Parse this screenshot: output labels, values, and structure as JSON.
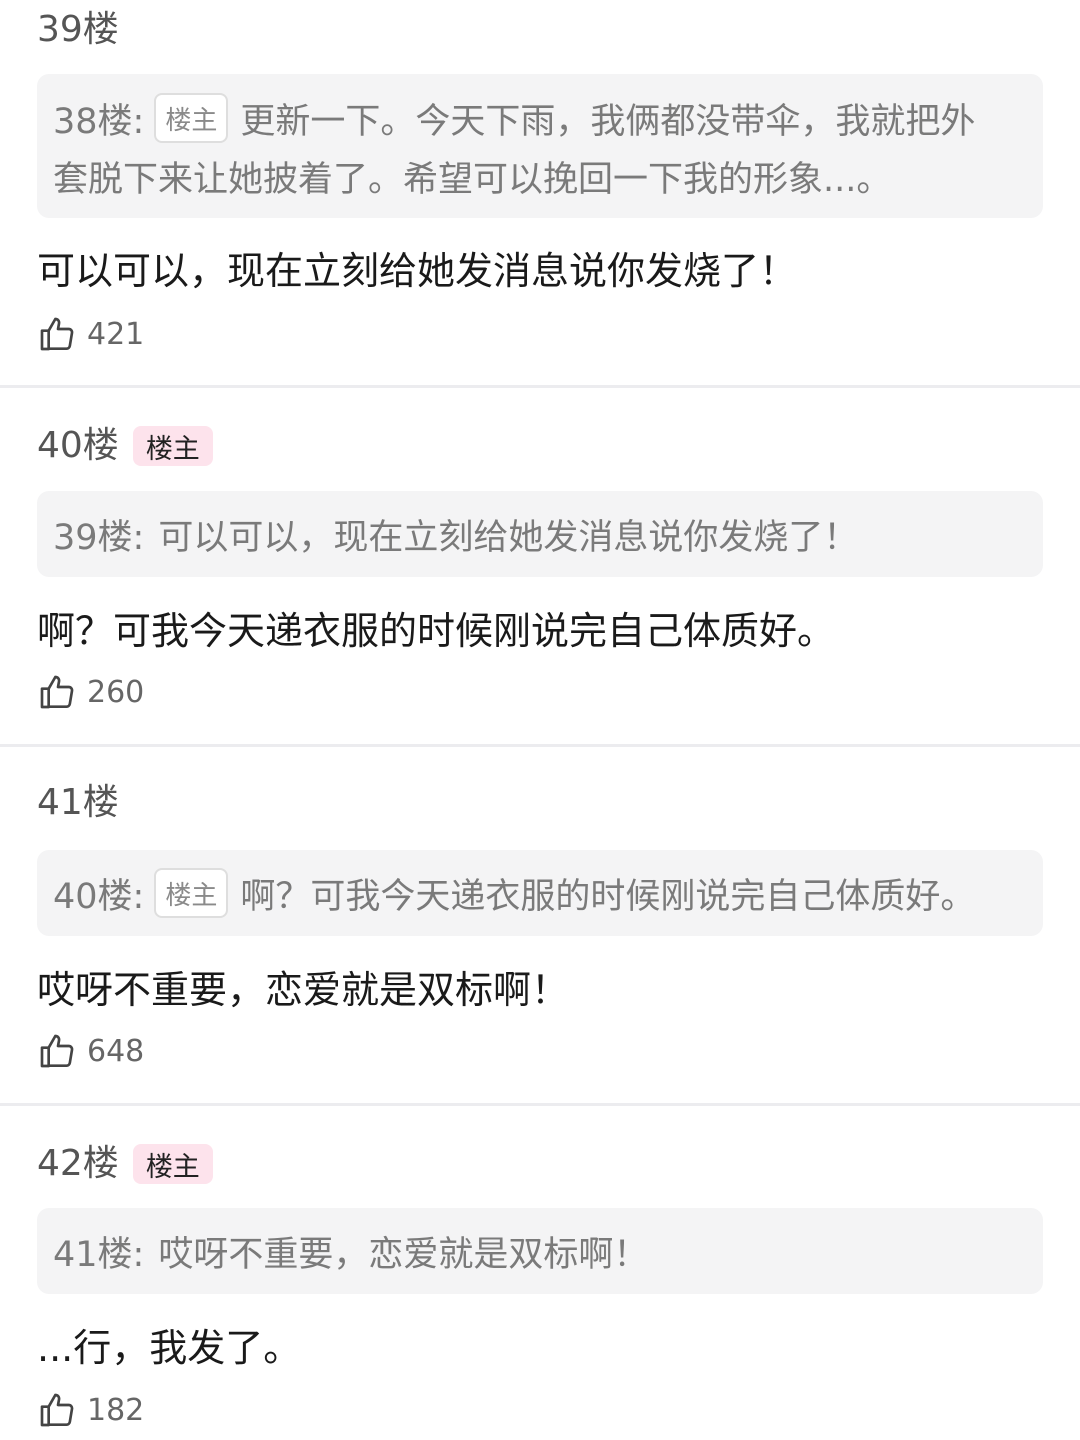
{
  "posts": [
    {
      "floor": "39楼",
      "quote": {
        "ref": "38楼:",
        "badge": "楼主",
        "line1": "更新一下。今天下雨，我俩都没带伞，我就把外",
        "line2": "套脱下来让她披着了。希望可以挽回一下我的形象...。"
      },
      "reply": "可以可以，现在立刻给她发消息说你发烧了！",
      "likes": "421"
    },
    {
      "floor": "40楼",
      "badge": "楼主",
      "quote": {
        "ref": "39楼:",
        "text": "可以可以，现在立刻给她发消息说你发烧了！"
      },
      "reply": "啊？可我今天递衣服的时候刚说完自己体质好。",
      "likes": "260"
    },
    {
      "floor": "41楼",
      "quote": {
        "ref": "40楼:",
        "badge": "楼主",
        "text": "啊？可我今天递衣服的时候刚说完自己体质好。"
      },
      "reply": "哎呀不重要，恋爱就是双标啊！",
      "likes": "648"
    },
    {
      "floor": "42楼",
      "badge": "楼主",
      "quote": {
        "ref": "41楼:",
        "text": "哎呀不重要，恋爱就是双标啊！"
      },
      "reply": "...行，我发了。",
      "likes": "182"
    }
  ],
  "icons": {
    "like": "thumbs-up-icon"
  },
  "colors": {
    "op_badge_bg": "#fde3ec",
    "quote_bg": "#f4f4f5",
    "divider": "#ececef"
  }
}
